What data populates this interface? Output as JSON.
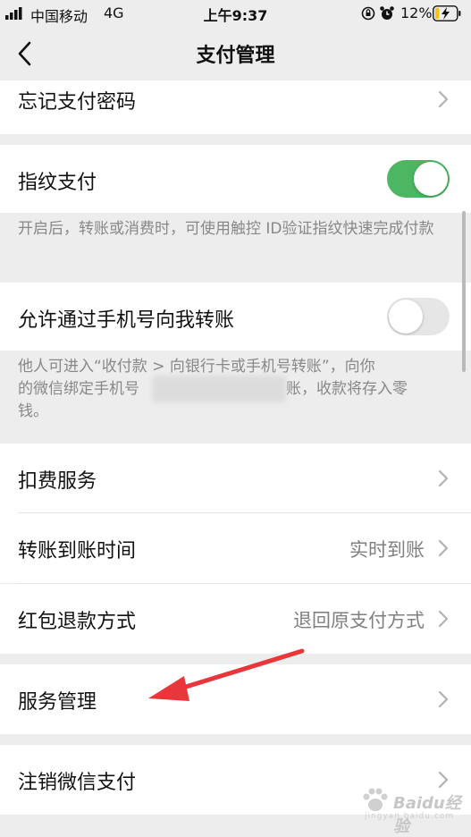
{
  "status_bar": {
    "carrier": "中国移动",
    "network": "4G",
    "time": "上午9:37",
    "battery_percent": "12%"
  },
  "nav": {
    "title": "支付管理"
  },
  "rows": {
    "forgot_password": "忘记支付密码",
    "fingerprint": "指纹支付",
    "fingerprint_desc": "开启后，转账或消费时，可使用触控 ID验证指纹快速完成付款",
    "phone_transfer": "允许通过手机号向我转账",
    "phone_transfer_desc_line1": "他人可进入“收付款 > 向银行卡或手机号转账”，向你",
    "phone_transfer_desc_line2_start": "的微信绑定手机号",
    "phone_transfer_desc_line2_end": "账，收款将存入零",
    "phone_transfer_desc_line3": "钱。",
    "deduction_service": "扣费服务",
    "transfer_time": "转账到账时间",
    "transfer_time_value": "实时到账",
    "redpacket_refund": "红包退款方式",
    "redpacket_refund_value": "退回原支付方式",
    "service_management": "服务管理",
    "cancel_wechat_pay": "注销微信支付"
  },
  "toggles": {
    "fingerprint_on": true,
    "phone_transfer_on": false
  },
  "watermark": {
    "text": "Baidu经验",
    "sub": "jingyan.baidu.com"
  },
  "colors": {
    "accent_green": "#4cb662",
    "background": "#ededed",
    "annotation_arrow": "#e8363a"
  }
}
